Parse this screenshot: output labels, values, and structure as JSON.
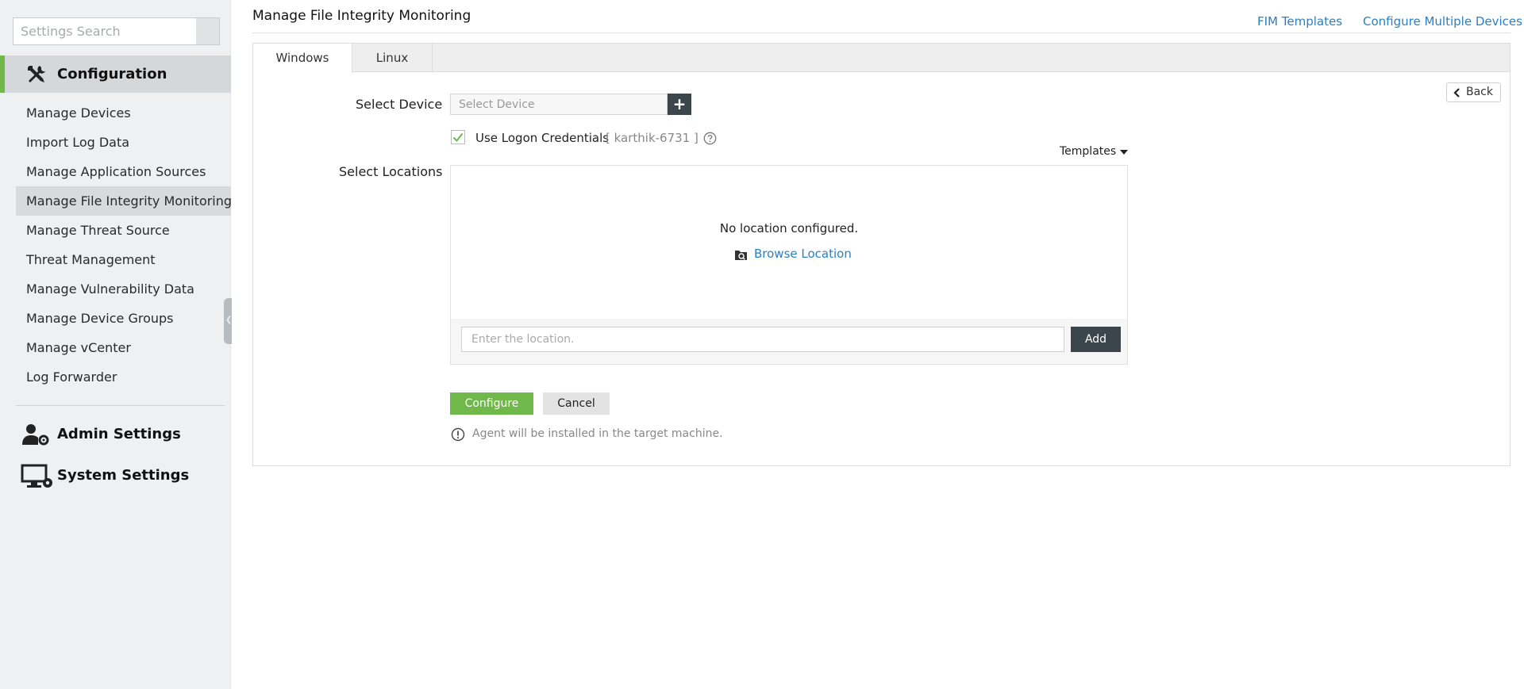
{
  "sidebar": {
    "search_placeholder": "Settings Search",
    "configuration_title": "Configuration",
    "items": [
      {
        "label": "Manage Devices"
      },
      {
        "label": "Import Log Data"
      },
      {
        "label": "Manage Application Sources"
      },
      {
        "label": "Manage File Integrity Monitoring",
        "active": true
      },
      {
        "label": "Manage Threat Source"
      },
      {
        "label": "Threat Management"
      },
      {
        "label": "Manage Vulnerability Data"
      },
      {
        "label": "Manage Device Groups"
      },
      {
        "label": "Manage vCenter"
      },
      {
        "label": "Log Forwarder"
      }
    ],
    "admin_title": "Admin Settings",
    "system_title": "System Settings"
  },
  "header": {
    "title": "Manage File Integrity Monitoring",
    "link_fim_templates": "FIM Templates",
    "link_configure_multiple": "Configure Multiple Devices"
  },
  "tabs": [
    {
      "label": "Windows",
      "selected": true
    },
    {
      "label": "Linux",
      "selected": false
    }
  ],
  "form": {
    "back_label": "Back",
    "select_device_label": "Select Device",
    "device_placeholder": "Select Device",
    "use_logon_credentials_label": "Use Logon Credentials",
    "logon_checked": true,
    "credential_user": "[ karthik-6731 ]",
    "templates_label": "Templates",
    "select_locations_label": "Select Locations",
    "no_location_text": "No location configured.",
    "browse_location_label": "Browse Location",
    "location_placeholder": "Enter the location.",
    "add_label": "Add",
    "configure_label": "Configure",
    "cancel_label": "Cancel",
    "agent_note": "Agent will be installed in the target machine."
  },
  "colors": {
    "accent_green": "#71b84a",
    "link_blue": "#2a7fc0",
    "dark_button": "#3b454c",
    "sidebar_bg": "#eef0f1"
  }
}
